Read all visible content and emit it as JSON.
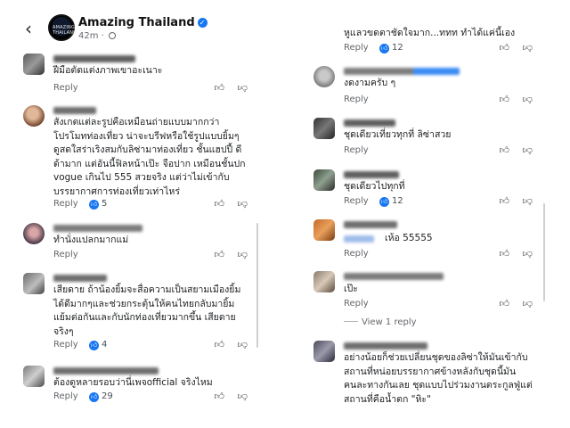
{
  "header": {
    "page_name": "Amazing Thailand",
    "time": "42m",
    "avatar_text": "AMAZING THAILAND"
  },
  "actions": {
    "reply_label": "Reply",
    "view_replies_label": "View 1 reply"
  },
  "left_comments": [
    {
      "text": "ฝีมือตัดแต่งภาพเขาอะเนาะ",
      "likes": ""
    },
    {
      "text": "สังเกตแต่ละรูปคือเหมือนถ่ายแบบมากกว่า\nโปรโมทท่องเที่ยว น่าจะบรีฟหรือใช้รูปแบบยิ้มๆ\nดูสดใสร่าเริงสมกับลิซ่ามาท่องเที่ยว ชั้นแฮปปี้ ดี\nด้ามาก แต่อันนี้ฟิลหน้าเป๊ะ จือปาก เหมือนชั้นปก\nvogue เกินไป 555 สวยจริง แต่ว่าไม่เข้ากับ\nบรรยากาศการท่องเที่ยวเท่าไหร่",
      "likes": "5"
    },
    {
      "text": "ทำนั่งแปลกมากแม่",
      "likes": ""
    },
    {
      "text": "เสียดาย ถ้าน้องยิ้มจะสื่อความเป็นสยามเมืองยิ้ม\nได้ดีมากๆและช่วยกระตุ้นให้คนไทยกลับมายิ้ม\nแย้มต่อกันและกับนักท่องเที่ยวมากขึ้น เสียดาย\nจริงๆ",
      "likes": "4"
    },
    {
      "text": "ต้องดูหลายรอบว่านี่เพจofficial จริงไหม",
      "likes": "29"
    }
  ],
  "right_comments": [
    {
      "text": "หูแลวขดตาชัดใจมาก...ททท ทำได้แค่นี้เอง",
      "likes": "12"
    },
    {
      "text": "งดงามครับ ๆ",
      "likes": ""
    },
    {
      "text": "ชุดเดียวเที่ยวทุกที่ ลิซ่าสวย",
      "likes": ""
    },
    {
      "text": "ชุดเดียวไปทุกที่",
      "likes": "12"
    },
    {
      "text": "เห้อ 55555",
      "likes": ""
    },
    {
      "text": "เป๊ะ",
      "likes": ""
    },
    {
      "text": "อย่างน้อยก็ช่วยเปลี่ยนชุดของลิซ่าให้มันเข้ากับ\nสถานที่หน่อยบรรยากาศข้างหลังกับชุดนี้มัน\nคนละทางกันเลย ชุดแบบไปร่วมงานตระกูลฟู่แต่\nสถานที่คือน้ำตก \"หิะ\"",
      "likes": ""
    }
  ],
  "colors": {
    "accent": "#1877f2",
    "secondary_text": "#65676b"
  },
  "icons": [
    "back-arrow-icon",
    "verified-badge-icon",
    "globe-icon",
    "like-badge-icon",
    "thumb-up-icon",
    "thumb-down-icon"
  ]
}
